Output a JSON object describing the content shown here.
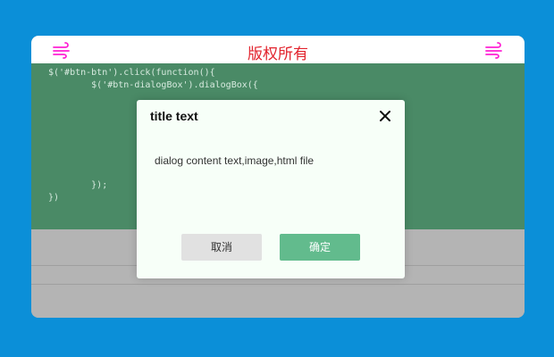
{
  "header": {
    "title": "版权所有",
    "left_icon": "wind-icon",
    "right_icon": "wind-icon",
    "title_color": "#e2232d",
    "icon_color": "#ff21d4"
  },
  "code_snippet": {
    "lines": [
      "$('#btn-btn').click(function(){",
      "        $('#btn-dialogBox').dialogBox({",
      "",
      "",
      "",
      "",
      "",
      "",
      "",
      "        });",
      "})"
    ]
  },
  "dialog": {
    "title": "title text",
    "content": "dialog content text,image,html file",
    "close_icon": "close-icon",
    "cancel_label": "取消",
    "confirm_label": "确定",
    "confirm_color": "#62bb8d"
  },
  "colors": {
    "background": "#0b8fd8",
    "code_background": "#4a8a66",
    "lower_background": "#b4b4b4"
  }
}
